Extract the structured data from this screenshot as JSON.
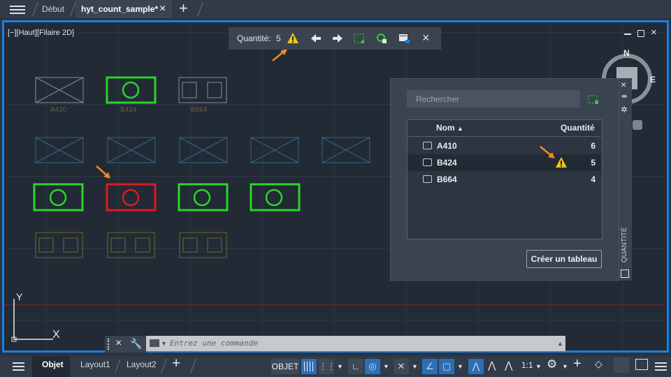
{
  "tabs": {
    "start": "Début",
    "active": "hyt_count_sample*",
    "close": "×",
    "add": "+"
  },
  "viewport": {
    "label": "[−][Haut][Filaire 2D]"
  },
  "count_toolbar": {
    "label": "Quantité:",
    "value": "5",
    "close": "×"
  },
  "blocks": {
    "captions": [
      "A410",
      "B424",
      "B664"
    ]
  },
  "compass": {
    "n": "N",
    "e": "E"
  },
  "ucs": {
    "y": "Y",
    "x": "X"
  },
  "palette": {
    "title": "QUANTITÉ",
    "search_placeholder": "Rechercher",
    "columns": {
      "name": "Nom",
      "count": "Quantité"
    },
    "rows": [
      {
        "name": "A410",
        "count": "6",
        "warning": false
      },
      {
        "name": "B424",
        "count": "5",
        "warning": true
      },
      {
        "name": "B664",
        "count": "4",
        "warning": false
      }
    ],
    "create_table": "Créer un tableau"
  },
  "command_line": {
    "placeholder": "Entrez une commande"
  },
  "bottom": {
    "tabs": [
      "Objet",
      "Layout1",
      "Layout2"
    ],
    "add": "+",
    "objet_btn": "OBJET",
    "scale": "1:1"
  },
  "colors": {
    "accent": "#1c7fe0",
    "green": "#2bd42b",
    "red": "#e0181f",
    "warning": "#f5c518",
    "arrow": "#f08a24"
  }
}
